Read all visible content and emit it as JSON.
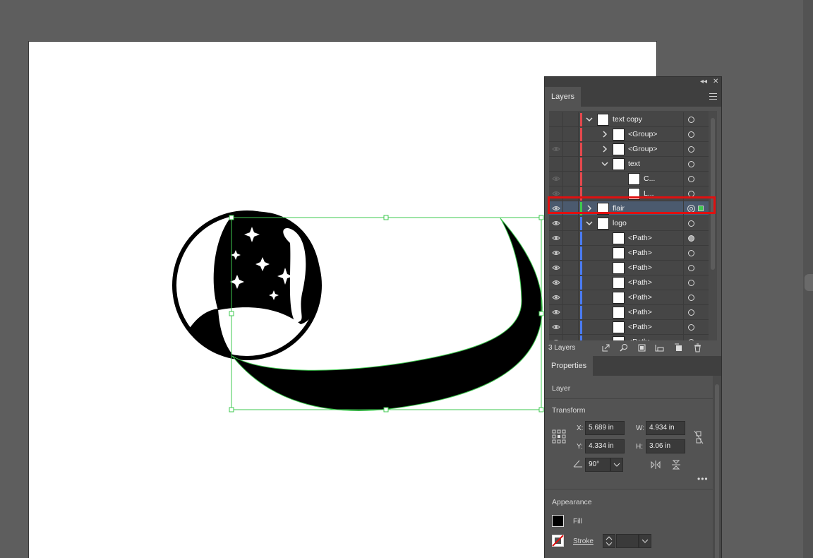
{
  "layers_panel": {
    "tab_label": "Layers",
    "footer_count": "3 Layers",
    "rows": [
      {
        "label": "text copy",
        "color": "#e5484d",
        "expanded": true,
        "visible": false
      },
      {
        "label": "<Group>",
        "color": "#e5484d",
        "expanded": false,
        "visible": false
      },
      {
        "label": "<Group>",
        "color": "#e5484d",
        "expanded": false,
        "visible": true
      },
      {
        "label": "text",
        "color": "#e5484d",
        "expanded": true,
        "visible": false
      },
      {
        "label": "C...",
        "color": "#e5484d",
        "visible": true
      },
      {
        "label": "L...",
        "color": "#e5484d",
        "visible": true
      },
      {
        "label": "flair",
        "color": "#3ec94f",
        "expanded": false,
        "visible": true,
        "selected": true
      },
      {
        "label": "logo",
        "color": "#4a7bf2",
        "expanded": true,
        "visible": true
      },
      {
        "label": "<Path>",
        "color": "#4a7bf2",
        "visible": true
      },
      {
        "label": "<Path>",
        "color": "#4a7bf2",
        "visible": true
      },
      {
        "label": "<Path>",
        "color": "#4a7bf2",
        "visible": true
      },
      {
        "label": "<Path>",
        "color": "#4a7bf2",
        "visible": true
      },
      {
        "label": "<Path>",
        "color": "#4a7bf2",
        "visible": true
      },
      {
        "label": "<Path>",
        "color": "#4a7bf2",
        "visible": true
      },
      {
        "label": "<Path>",
        "color": "#4a7bf2",
        "visible": true
      },
      {
        "label": "<Path>",
        "color": "#4a7bf2",
        "visible": true
      }
    ]
  },
  "properties_panel": {
    "tab_label": "Properties",
    "layer_label": "Layer",
    "transform_label": "Transform",
    "x_label": "X:",
    "x_value": "5.689 in",
    "y_label": "Y:",
    "y_value": "4.334 in",
    "w_label": "W:",
    "w_value": "4.934 in",
    "h_label": "H:",
    "h_value": "3.06 in",
    "angle_value": "90°",
    "appearance_label": "Appearance",
    "fill_label": "Fill",
    "stroke_label": "Stroke"
  },
  "colors": {
    "selection_green": "#3ec94f",
    "highlight_red": "#e01010",
    "panel_bg": "#535353"
  }
}
